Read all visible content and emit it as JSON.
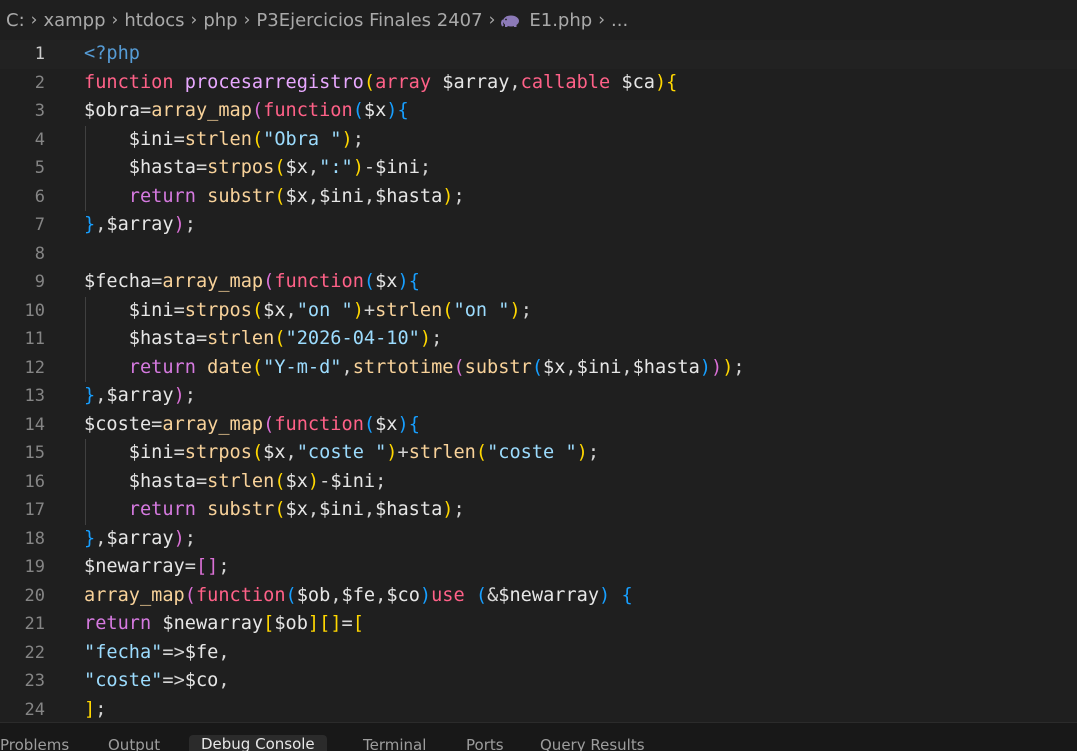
{
  "breadcrumb": {
    "segments": [
      "C:",
      "xampp",
      "htdocs",
      "php",
      "P3Ejercicios Finales 2407"
    ],
    "file": "E1.php",
    "trailing": "..."
  },
  "editor": {
    "current_line": 1,
    "lines": [
      {
        "n": "1",
        "t": [
          [
            "k-tag",
            "<?php"
          ]
        ]
      },
      {
        "n": "2",
        "t": [
          [
            "k-storage",
            "function "
          ],
          [
            "k-fn",
            "procesarregistro"
          ],
          [
            "b1",
            "("
          ],
          [
            "k-storage",
            "array "
          ],
          [
            "k-var",
            "$array"
          ],
          [
            "k-punc",
            ","
          ],
          [
            "k-storage",
            "callable "
          ],
          [
            "k-var",
            "$ca"
          ],
          [
            "b1",
            ")"
          ],
          [
            "b1",
            "{"
          ]
        ]
      },
      {
        "n": "3",
        "t": [
          [
            "k-var",
            "$obra"
          ],
          [
            "k-op",
            "="
          ],
          [
            "k-fn-call",
            "array_map"
          ],
          [
            "b2",
            "("
          ],
          [
            "k-storage",
            "function"
          ],
          [
            "b3",
            "("
          ],
          [
            "k-var",
            "$x"
          ],
          [
            "b3",
            ")"
          ],
          [
            "b3",
            "{"
          ]
        ]
      },
      {
        "n": "4",
        "t": [
          [
            "k-var",
            "    $ini"
          ],
          [
            "k-op",
            "="
          ],
          [
            "k-fn-call",
            "strlen"
          ],
          [
            "b1",
            "("
          ],
          [
            "k-str",
            "\"Obra \""
          ],
          [
            "b1",
            ")"
          ],
          [
            "k-punc",
            ";"
          ]
        ]
      },
      {
        "n": "5",
        "t": [
          [
            "k-var",
            "    $hasta"
          ],
          [
            "k-op",
            "="
          ],
          [
            "k-fn-call",
            "strpos"
          ],
          [
            "b1",
            "("
          ],
          [
            "k-var",
            "$x"
          ],
          [
            "k-punc",
            ","
          ],
          [
            "k-str",
            "\":\""
          ],
          [
            "b1",
            ")"
          ],
          [
            "k-op",
            "-"
          ],
          [
            "k-var",
            "$ini"
          ],
          [
            "k-punc",
            ";"
          ]
        ]
      },
      {
        "n": "6",
        "t": [
          [
            "k-ctrl",
            "    return "
          ],
          [
            "k-fn-call",
            "substr"
          ],
          [
            "b1",
            "("
          ],
          [
            "k-var",
            "$x"
          ],
          [
            "k-punc",
            ","
          ],
          [
            "k-var",
            "$ini"
          ],
          [
            "k-punc",
            ","
          ],
          [
            "k-var",
            "$hasta"
          ],
          [
            "b1",
            ")"
          ],
          [
            "k-punc",
            ";"
          ]
        ]
      },
      {
        "n": "7",
        "t": [
          [
            "b3",
            "}"
          ],
          [
            "k-punc",
            ","
          ],
          [
            "k-var",
            "$array"
          ],
          [
            "b2",
            ")"
          ],
          [
            "k-punc",
            ";"
          ]
        ]
      },
      {
        "n": "8",
        "t": []
      },
      {
        "n": "9",
        "t": [
          [
            "k-var",
            "$fecha"
          ],
          [
            "k-op",
            "="
          ],
          [
            "k-fn-call",
            "array_map"
          ],
          [
            "b2",
            "("
          ],
          [
            "k-storage",
            "function"
          ],
          [
            "b3",
            "("
          ],
          [
            "k-var",
            "$x"
          ],
          [
            "b3",
            ")"
          ],
          [
            "b3",
            "{"
          ]
        ]
      },
      {
        "n": "10",
        "t": [
          [
            "k-var",
            "    $ini"
          ],
          [
            "k-op",
            "="
          ],
          [
            "k-fn-call",
            "strpos"
          ],
          [
            "b1",
            "("
          ],
          [
            "k-var",
            "$x"
          ],
          [
            "k-punc",
            ","
          ],
          [
            "k-str",
            "\"on \""
          ],
          [
            "b1",
            ")"
          ],
          [
            "k-op",
            "+"
          ],
          [
            "k-fn-call",
            "strlen"
          ],
          [
            "b1",
            "("
          ],
          [
            "k-str",
            "\"on \""
          ],
          [
            "b1",
            ")"
          ],
          [
            "k-punc",
            ";"
          ]
        ]
      },
      {
        "n": "11",
        "t": [
          [
            "k-var",
            "    $hasta"
          ],
          [
            "k-op",
            "="
          ],
          [
            "k-fn-call",
            "strlen"
          ],
          [
            "b1",
            "("
          ],
          [
            "k-str",
            "\"2026-04-10\""
          ],
          [
            "b1",
            ")"
          ],
          [
            "k-punc",
            ";"
          ]
        ]
      },
      {
        "n": "12",
        "t": [
          [
            "k-ctrl",
            "    return "
          ],
          [
            "k-fn-call",
            "date"
          ],
          [
            "b1",
            "("
          ],
          [
            "k-str",
            "\"Y-m-d\""
          ],
          [
            "k-punc",
            ","
          ],
          [
            "k-fn-call",
            "strtotime"
          ],
          [
            "b2",
            "("
          ],
          [
            "k-fn-call",
            "substr"
          ],
          [
            "b3",
            "("
          ],
          [
            "k-var",
            "$x"
          ],
          [
            "k-punc",
            ","
          ],
          [
            "k-var",
            "$ini"
          ],
          [
            "k-punc",
            ","
          ],
          [
            "k-var",
            "$hasta"
          ],
          [
            "b3",
            ")"
          ],
          [
            "b2",
            ")"
          ],
          [
            "b1",
            ")"
          ],
          [
            "k-punc",
            ";"
          ]
        ]
      },
      {
        "n": "13",
        "t": [
          [
            "b3",
            "}"
          ],
          [
            "k-punc",
            ","
          ],
          [
            "k-var",
            "$array"
          ],
          [
            "b2",
            ")"
          ],
          [
            "k-punc",
            ";"
          ]
        ]
      },
      {
        "n": "14",
        "t": [
          [
            "k-var",
            "$coste"
          ],
          [
            "k-op",
            "="
          ],
          [
            "k-fn-call",
            "array_map"
          ],
          [
            "b2",
            "("
          ],
          [
            "k-storage",
            "function"
          ],
          [
            "b3",
            "("
          ],
          [
            "k-var",
            "$x"
          ],
          [
            "b3",
            ")"
          ],
          [
            "b3",
            "{"
          ]
        ]
      },
      {
        "n": "15",
        "t": [
          [
            "k-var",
            "    $ini"
          ],
          [
            "k-op",
            "="
          ],
          [
            "k-fn-call",
            "strpos"
          ],
          [
            "b1",
            "("
          ],
          [
            "k-var",
            "$x"
          ],
          [
            "k-punc",
            ","
          ],
          [
            "k-str",
            "\"coste \""
          ],
          [
            "b1",
            ")"
          ],
          [
            "k-op",
            "+"
          ],
          [
            "k-fn-call",
            "strlen"
          ],
          [
            "b1",
            "("
          ],
          [
            "k-str",
            "\"coste \""
          ],
          [
            "b1",
            ")"
          ],
          [
            "k-punc",
            ";"
          ]
        ]
      },
      {
        "n": "16",
        "t": [
          [
            "k-var",
            "    $hasta"
          ],
          [
            "k-op",
            "="
          ],
          [
            "k-fn-call",
            "strlen"
          ],
          [
            "b1",
            "("
          ],
          [
            "k-var",
            "$x"
          ],
          [
            "b1",
            ")"
          ],
          [
            "k-op",
            "-"
          ],
          [
            "k-var",
            "$ini"
          ],
          [
            "k-punc",
            ";"
          ]
        ]
      },
      {
        "n": "17",
        "t": [
          [
            "k-ctrl",
            "    return "
          ],
          [
            "k-fn-call",
            "substr"
          ],
          [
            "b1",
            "("
          ],
          [
            "k-var",
            "$x"
          ],
          [
            "k-punc",
            ","
          ],
          [
            "k-var",
            "$ini"
          ],
          [
            "k-punc",
            ","
          ],
          [
            "k-var",
            "$hasta"
          ],
          [
            "b1",
            ")"
          ],
          [
            "k-punc",
            ";"
          ]
        ]
      },
      {
        "n": "18",
        "t": [
          [
            "b3",
            "}"
          ],
          [
            "k-punc",
            ","
          ],
          [
            "k-var",
            "$array"
          ],
          [
            "b2",
            ")"
          ],
          [
            "k-punc",
            ";"
          ]
        ]
      },
      {
        "n": "19",
        "t": [
          [
            "k-var",
            "$newarray"
          ],
          [
            "k-op",
            "="
          ],
          [
            "b2",
            "[]"
          ],
          [
            "k-punc",
            ";"
          ]
        ]
      },
      {
        "n": "20",
        "t": [
          [
            "k-fn-call",
            "array_map"
          ],
          [
            "b2",
            "("
          ],
          [
            "k-storage",
            "function"
          ],
          [
            "b3",
            "("
          ],
          [
            "k-var",
            "$ob"
          ],
          [
            "k-punc",
            ","
          ],
          [
            "k-var",
            "$fe"
          ],
          [
            "k-punc",
            ","
          ],
          [
            "k-var",
            "$co"
          ],
          [
            "b3",
            ")"
          ],
          [
            "k-storage",
            "use "
          ],
          [
            "b3",
            "("
          ],
          [
            "k-op",
            "&"
          ],
          [
            "k-var",
            "$newarray"
          ],
          [
            "b3",
            ")"
          ],
          [
            "k-punc",
            " "
          ],
          [
            "b3",
            "{"
          ]
        ]
      },
      {
        "n": "21",
        "t": [
          [
            "k-ctrl",
            "return "
          ],
          [
            "k-var",
            "$newarray"
          ],
          [
            "b1",
            "["
          ],
          [
            "k-var",
            "$ob"
          ],
          [
            "b1",
            "]"
          ],
          [
            "b1",
            "[]"
          ],
          [
            "k-op",
            "="
          ],
          [
            "b1",
            "["
          ]
        ]
      },
      {
        "n": "22",
        "t": [
          [
            "k-str",
            "\"fecha\""
          ],
          [
            "k-op",
            "=>"
          ],
          [
            "k-var",
            "$fe"
          ],
          [
            "k-punc",
            ","
          ]
        ]
      },
      {
        "n": "23",
        "t": [
          [
            "k-str",
            "\"coste\""
          ],
          [
            "k-op",
            "=>"
          ],
          [
            "k-var",
            "$co"
          ],
          [
            "k-punc",
            ","
          ]
        ]
      },
      {
        "n": "24",
        "t": [
          [
            "b1",
            "]"
          ],
          [
            "k-punc",
            ";"
          ]
        ]
      }
    ]
  },
  "panel": {
    "handle": "...",
    "tabs": [
      {
        "label": "Problems"
      },
      {
        "label": "Output"
      },
      {
        "label": "Debug Console",
        "active": true
      },
      {
        "label": "Terminal"
      },
      {
        "label": "Ports"
      },
      {
        "label": "Query Results"
      }
    ]
  },
  "colors": {
    "background": "#1f1f1f",
    "keyword_storage": "#ff6188",
    "function_name": "#e8a8ff",
    "string": "#9cdcfe",
    "bracket_level1": "#ffd700",
    "bracket_level2": "#da70d6",
    "bracket_level3": "#179fff"
  }
}
